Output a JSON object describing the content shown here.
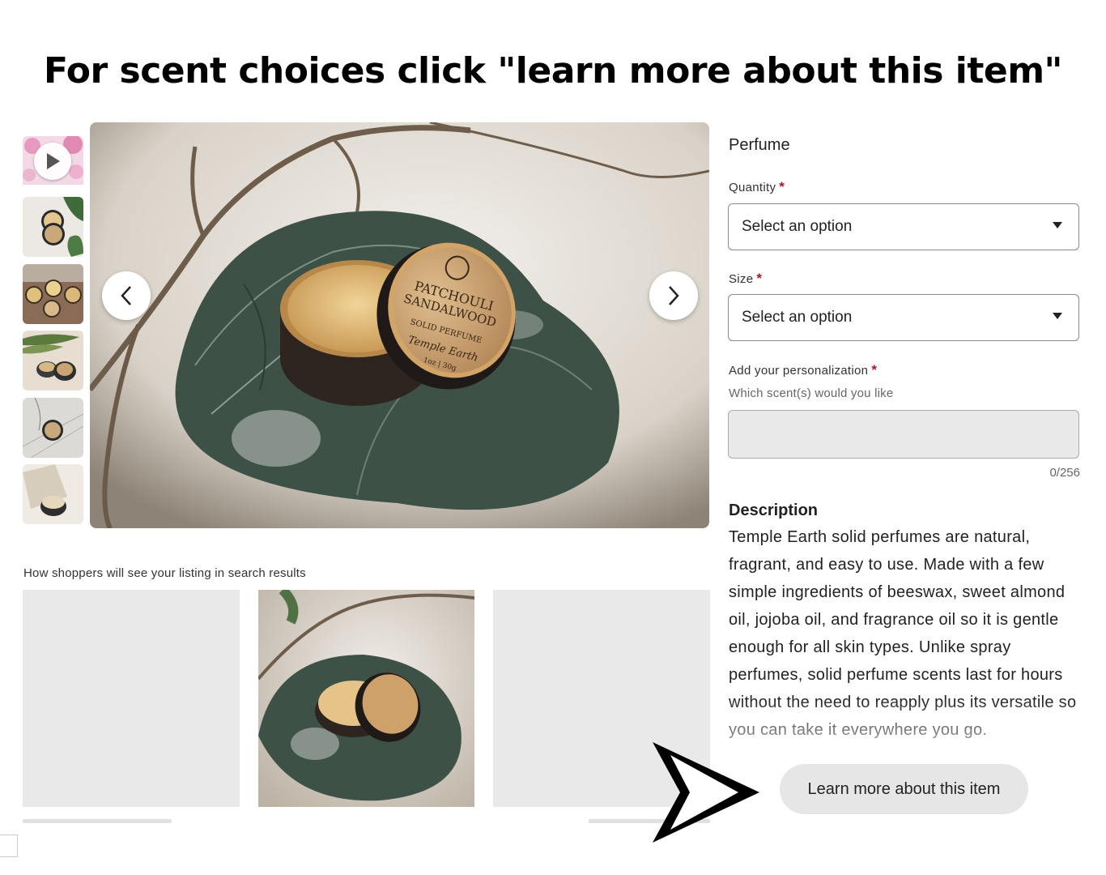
{
  "banner": {
    "text": "For scent choices click \"learn more about this item\""
  },
  "gallery": {
    "thumbnails": [
      {
        "name": "video"
      },
      {
        "name": "tin-leaf"
      },
      {
        "name": "tins-wood"
      },
      {
        "name": "tins-leaves"
      },
      {
        "name": "tin-white"
      },
      {
        "name": "tin-cloth"
      }
    ],
    "main_image_label_lines": [
      "PATCHOULI",
      "SANDALWOOD",
      "SOLID PERFUME",
      "Temple Earth",
      "1oz | 30g"
    ]
  },
  "preview": {
    "label": "How shoppers will see your listing in search results"
  },
  "product": {
    "title": "Perfume",
    "quantity_label": "Quantity",
    "quantity_value": "Select an option",
    "size_label": "Size",
    "size_value": "Select an option",
    "required_mark": "*",
    "personalization_label": "Add your personalization",
    "personalization_hint": "Which scent(s) would you like",
    "personalization_counter": "0/256",
    "description_heading": "Description",
    "description_text": "Temple Earth solid perfumes are natural, fragrant, and easy to use. Made with a few simple ingredients of beeswax, sweet almond oil, jojoba oil, and fragrance oil so it is gentle enough for all skin types. Unlike spray perfumes, solid perfume scents last for hours without the need to reapply plus its versatile so you can take it everywhere you go.",
    "learn_more_label": "Learn more about this item"
  },
  "colors": {
    "required": "#a61a2e",
    "field_fill": "#e9e9e9",
    "button_fill": "#e6e6e6"
  },
  "icons": {
    "play": "play-icon",
    "prev": "chevron-left-icon",
    "next": "chevron-right-icon",
    "caret": "caret-down-icon",
    "pointer": "arrow-pointer-icon"
  }
}
